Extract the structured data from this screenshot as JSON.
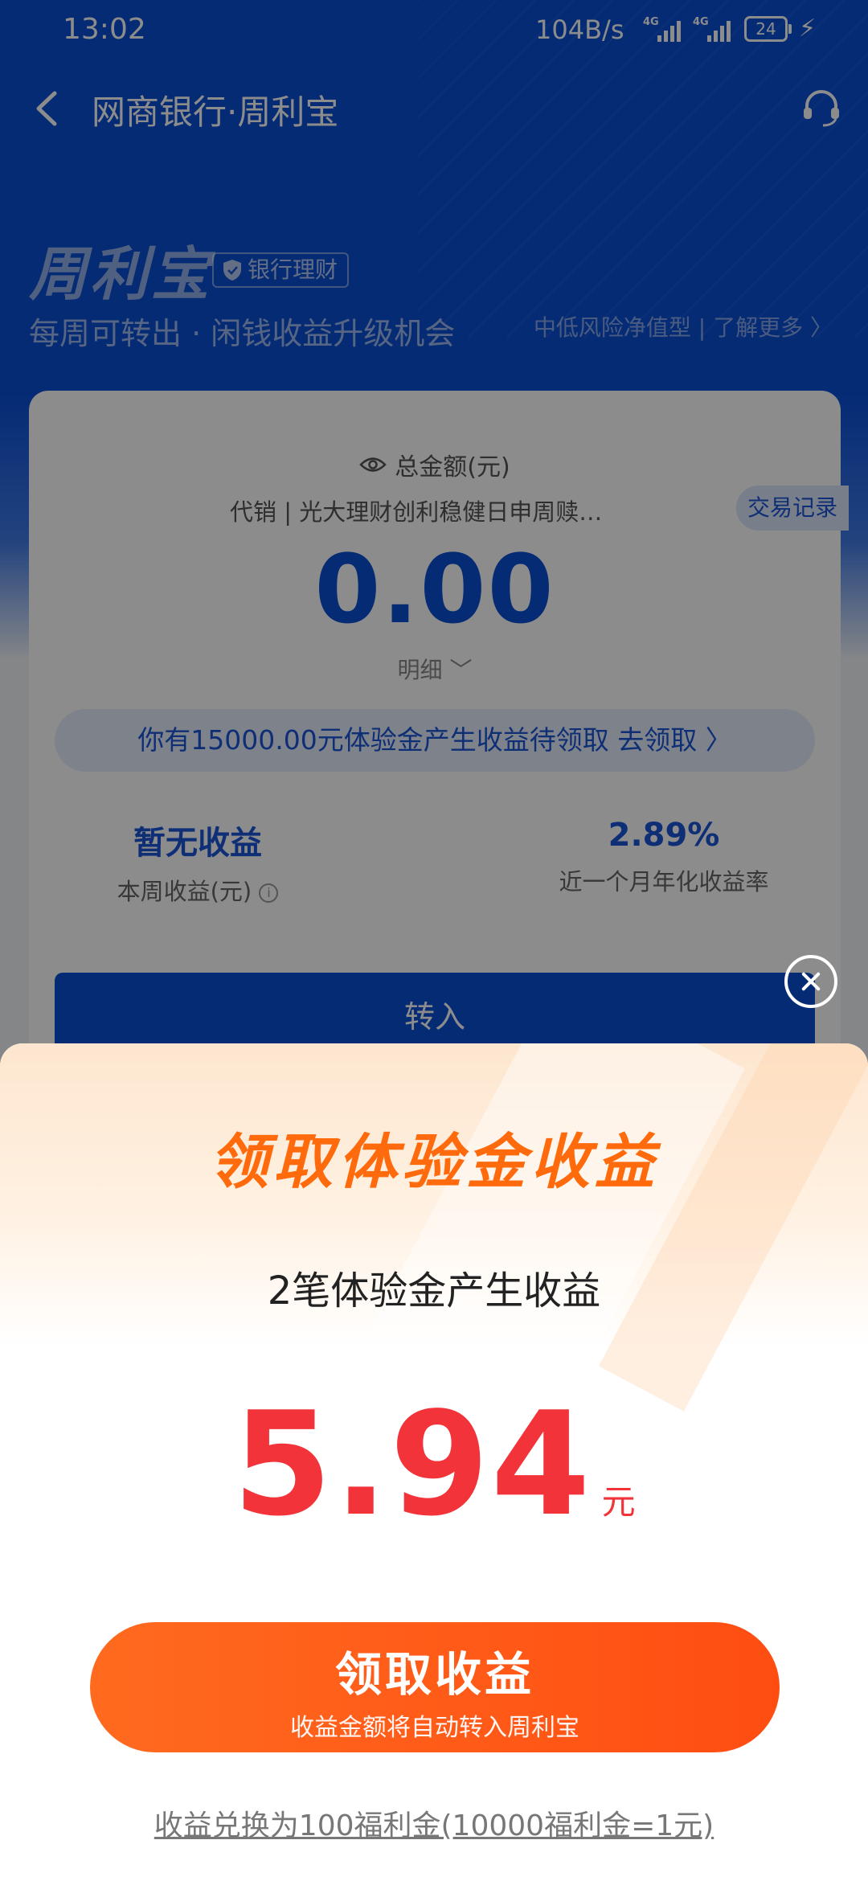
{
  "status_bar": {
    "time": "13:02",
    "net_speed": "104B/s",
    "signal_tag": "4G",
    "battery": "24"
  },
  "header": {
    "title": "网商银行·周利宝"
  },
  "brand": {
    "name": "周利宝",
    "badge": "银行理财",
    "slogan": "每周可转出 · 闲钱收益升级机会",
    "risk_link": "中低风险净值型 | 了解更多 〉"
  },
  "account_card": {
    "total_label": "总金额(元)",
    "product": "代销 | 光大理财创利稳健日申周赎…",
    "trade_record": "交易记录",
    "total_amount": "0.00",
    "detail": "明细 ﹀",
    "claim_banner": "你有15000.00元体验金产生收益待领取   去领取 〉",
    "stat_week_value": "暂无收益",
    "stat_week_label": "本周收益(元)",
    "stat_rate_value": "2.89%",
    "stat_rate_label": "近一个月年化收益率",
    "transfer_button": "转入"
  },
  "popup": {
    "title": "领取体验金收益",
    "subtitle": "2笔体验金产生收益",
    "amount": "5.94",
    "unit": "元",
    "claim_button": "领取收益",
    "claim_button_sub": "收益金额将自动转入周利宝",
    "exchange_link": "收益兑换为100福利金(10000福利金=1元)"
  },
  "colors": {
    "brand_blue": "#0b4fd6",
    "popup_orange": "#ff5a14",
    "amount_red": "#f2343a"
  }
}
